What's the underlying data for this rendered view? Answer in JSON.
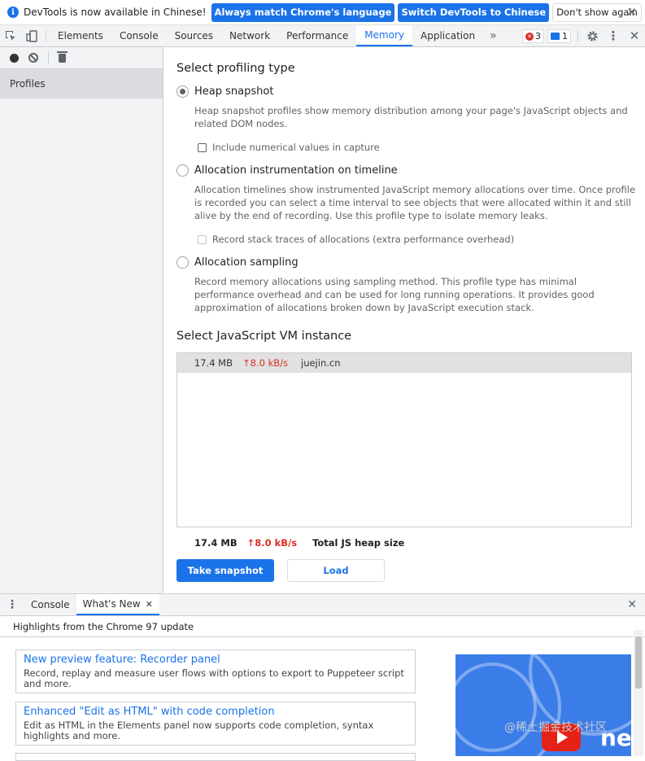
{
  "infobar": {
    "icon": "info-icon",
    "text": "DevTools is now available in Chinese!",
    "btn_match": "Always match Chrome's language",
    "btn_switch": "Switch DevTools to Chinese",
    "btn_dont_show": "Don't show again",
    "close": "✕"
  },
  "tabs": {
    "elements": "Elements",
    "console": "Console",
    "sources": "Sources",
    "network": "Network",
    "performance": "Performance",
    "memory": "Memory",
    "application": "Application",
    "more": "»",
    "errors_count": "3",
    "messages_count": "1"
  },
  "sidebar": {
    "profiles": "Profiles"
  },
  "main": {
    "select_type_heading": "Select profiling type",
    "heap_snapshot": {
      "label": "Heap snapshot",
      "desc": "Heap snapshot profiles show memory distribution among your page's JavaScript objects and related DOM nodes.",
      "checkbox": "Include numerical values in capture",
      "selected": true
    },
    "allocation_timeline": {
      "label": "Allocation instrumentation on timeline",
      "desc": "Allocation timelines show instrumented JavaScript memory allocations over time. Once profile is recorded you can select a time interval to see objects that were allocated within it and still alive by the end of recording. Use this profile type to isolate memory leaks.",
      "checkbox": "Record stack traces of allocations (extra performance overhead)"
    },
    "allocation_sampling": {
      "label": "Allocation sampling",
      "desc": "Record memory allocations using sampling method. This profile type has minimal performance overhead and can be used for long running operations. It provides good approximation of allocations broken down by JavaScript execution stack."
    },
    "vm_heading": "Select JavaScript VM instance",
    "vm_instances": [
      {
        "size": "17.4 MB",
        "rate": "↑8.0 kB/s",
        "url": "juejin.cn"
      }
    ],
    "summary": {
      "size": "17.4 MB",
      "rate": "↑8.0 kB/s",
      "label": "Total JS heap size"
    },
    "take_snapshot": "Take snapshot",
    "load": "Load"
  },
  "drawer": {
    "console_tab": "Console",
    "whats_new_tab": "What's New",
    "header": "Highlights from the Chrome 97 update",
    "cards": [
      {
        "title": "New preview feature: Recorder panel",
        "desc": "Record, replay and measure user flows with options to export to Puppeteer script and more."
      },
      {
        "title": "Enhanced \"Edit as HTML\" with code completion",
        "desc": "Edit as HTML in the Elements panel now supports code completion, syntax highlights and more."
      }
    ],
    "promo_text": "new",
    "watermark": "@稀土掘金技术社区"
  },
  "colors": {
    "accent": "#1a73e8",
    "error": "#d93025",
    "panel_bg": "#f1f3f4"
  }
}
